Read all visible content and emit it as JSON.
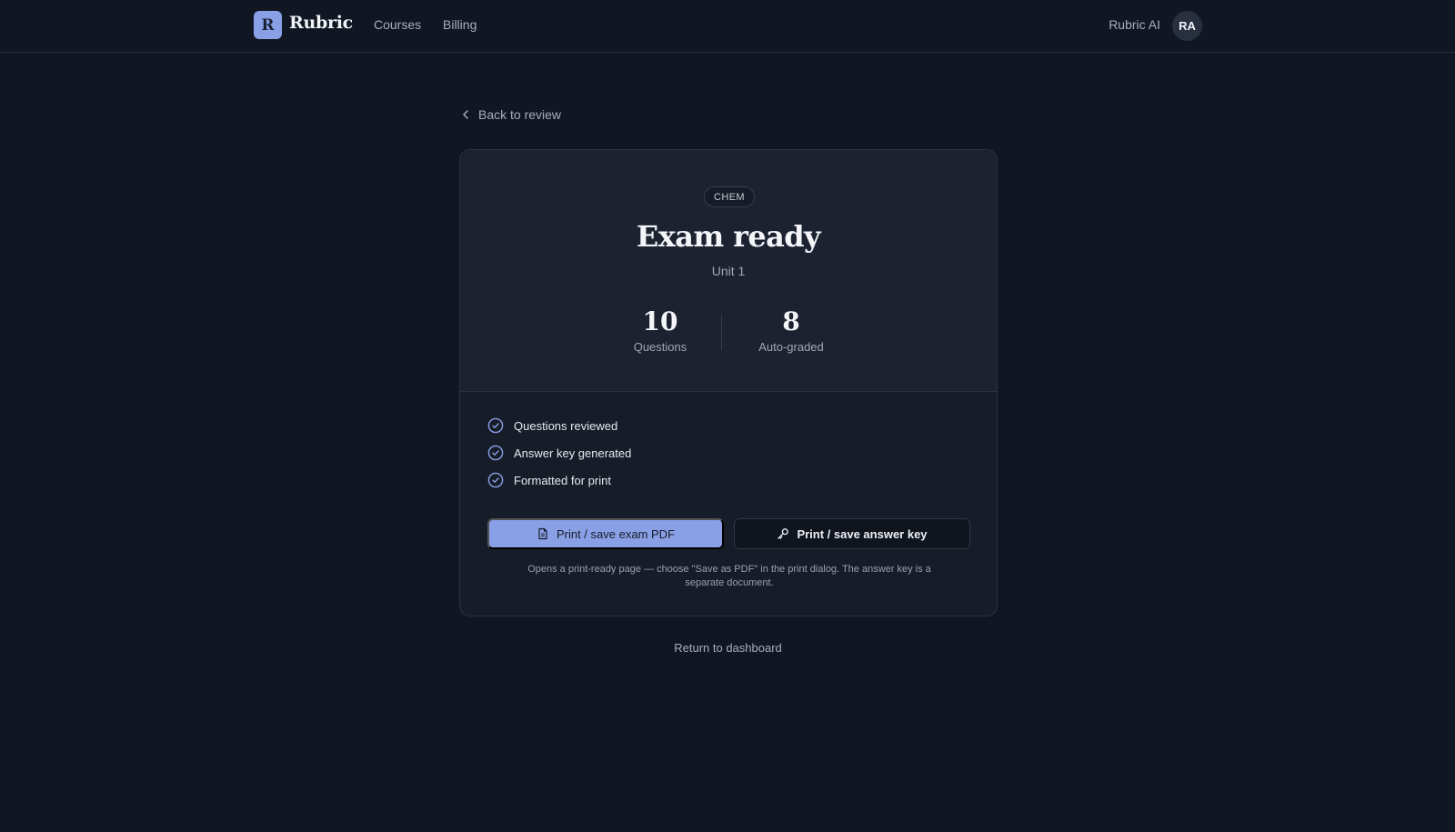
{
  "header": {
    "logo_letter": "R",
    "brand": "Rubric",
    "nav": [
      "Courses",
      "Billing"
    ],
    "user_name": "Rubric AI",
    "avatar_initials": "RA"
  },
  "back_link": "Back to review",
  "card": {
    "badge": "CHEM",
    "title": "Exam ready",
    "subtitle": "Unit 1",
    "stats": [
      {
        "value": "10",
        "label": "Questions"
      },
      {
        "value": "8",
        "label": "Auto-graded"
      }
    ],
    "checklist": [
      "Questions reviewed",
      "Answer key generated",
      "Formatted for print"
    ],
    "primary_button": "Print / save exam PDF",
    "secondary_button": "Print / save answer key",
    "hint": "Opens a print-ready page — choose \"Save as PDF\" in the print dialog. The answer key is a separate document."
  },
  "return_link": "Return to dashboard",
  "colors": {
    "background": "#111722",
    "accent": "#8aa0e6",
    "card": "#171d28"
  },
  "icons": [
    "chevron-left-icon",
    "check-circle-icon",
    "document-icon",
    "key-icon"
  ]
}
